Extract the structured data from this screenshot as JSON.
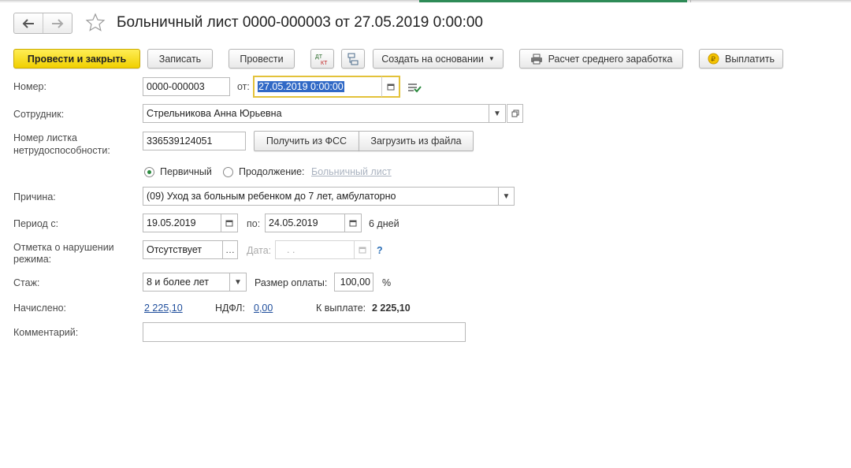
{
  "window": {
    "title": "Больничный лист 0000-000003 от 27.05.2019 0:00:00"
  },
  "toolbar": {
    "post_close": "Провести и закрыть",
    "save": "Записать",
    "post": "Провести",
    "create_based": "Создать на основании",
    "avg_earnings": "Расчет среднего заработка",
    "pay": "Выплатить"
  },
  "form": {
    "number_label": "Номер:",
    "number_value": "0000-000003",
    "date_label": "от:",
    "date_value": "27.05.2019  0:00:00",
    "employee_label": "Сотрудник:",
    "employee_value": "Стрельникова Анна Юрьевна",
    "sheet_label_1": "Номер листка",
    "sheet_label_2": "нетрудоспособности:",
    "sheet_value": "336539124051",
    "get_fss": "Получить из ФСС",
    "load_file": "Загрузить из файла",
    "primary_label": "Первичный",
    "continuation_label": "Продолжение:",
    "continuation_link": "Больничный лист",
    "reason_label": "Причина:",
    "reason_value": "(09) Уход за больным ребенком до 7 лет, амбулаторно",
    "period_label": "Период с:",
    "period_from": "19.05.2019",
    "period_to_label": "по:",
    "period_to": "24.05.2019",
    "days": "6 дней",
    "violation_label_1": "Отметка о нарушении",
    "violation_label_2": "режима:",
    "violation_value": "Отсутствует",
    "violation_date_label": "Дата:",
    "violation_date_value": ".   .",
    "help": "?",
    "experience_label": "Стаж:",
    "experience_value": "8 и более лет",
    "pay_size_label": "Размер оплаты:",
    "pay_size_value": "100,00",
    "percent": "%",
    "accrued_label": "Начислено:",
    "accrued_value": "2 225,10",
    "ndfl_label": "НДФЛ:",
    "ndfl_value": "0,00",
    "to_pay_label": "К выплате:",
    "to_pay_value": "2 225,10",
    "comment_label": "Комментарий:",
    "comment_value": ""
  },
  "colors": {
    "primary": "#f5d800",
    "accent_green": "#2b8a3e",
    "focus": "#e3c23a",
    "link": "#1f4e9c"
  }
}
